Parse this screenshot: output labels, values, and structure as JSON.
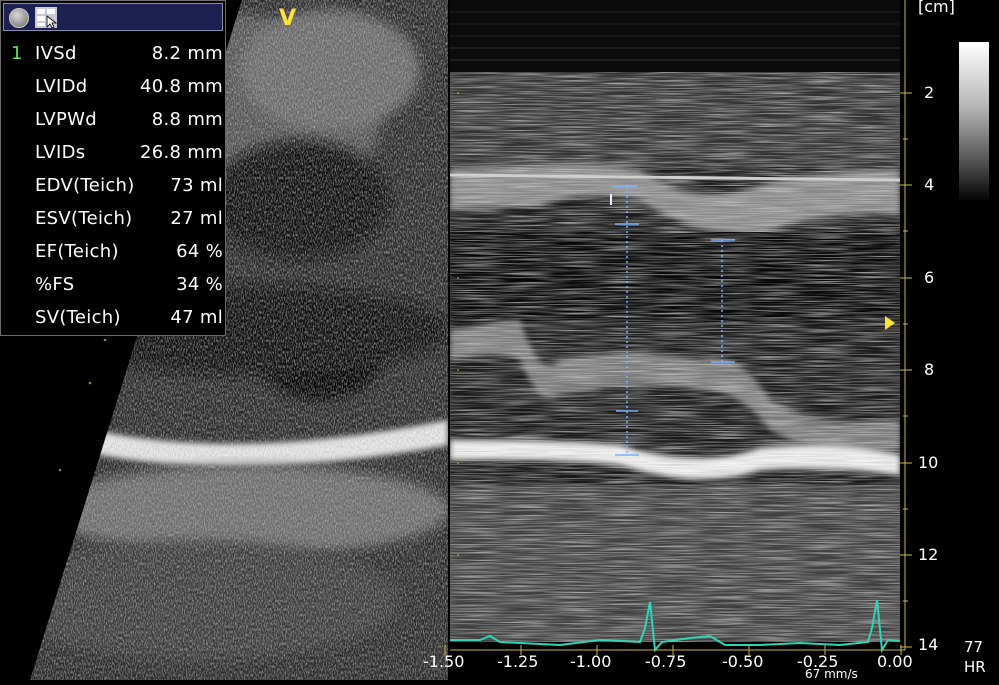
{
  "panel": {
    "rows": [
      {
        "num": "1",
        "label": "IVSd",
        "value": "8.2 mm"
      },
      {
        "num": "",
        "label": "LVIDd",
        "value": "40.8 mm"
      },
      {
        "num": "",
        "label": "LVPWd",
        "value": "8.8 mm"
      },
      {
        "num": "",
        "label": "LVIDs",
        "value": "26.8 mm"
      },
      {
        "num": "",
        "label": "EDV(Teich)",
        "value": "73 ml"
      },
      {
        "num": "",
        "label": "ESV(Teich)",
        "value": "27 ml"
      },
      {
        "num": "",
        "label": "EF(Teich)",
        "value": "64 %"
      },
      {
        "num": "",
        "label": "%FS",
        "value": "34 %"
      },
      {
        "num": "",
        "label": "SV(Teich)",
        "value": "47 ml"
      }
    ]
  },
  "probe_marker": "V",
  "depth_scale": {
    "unit": "[cm]",
    "ticks": [
      "2",
      "4",
      "6",
      "8",
      "10",
      "12",
      "14"
    ]
  },
  "time_scale": {
    "ticks": [
      "-1.50",
      "-1.25",
      "-1.00",
      "-0.75",
      "-0.50",
      "-0.25",
      "0.00"
    ],
    "sweep": "67 mm/s"
  },
  "heart_rate": {
    "value": "77",
    "label": "HR"
  },
  "colors": {
    "ecg": "#2fd6b6",
    "caliper": "#7fb2ff",
    "scale_marker": "#ffe23a",
    "panel_header": "#1c2152",
    "row_number": "#5ee05e"
  }
}
